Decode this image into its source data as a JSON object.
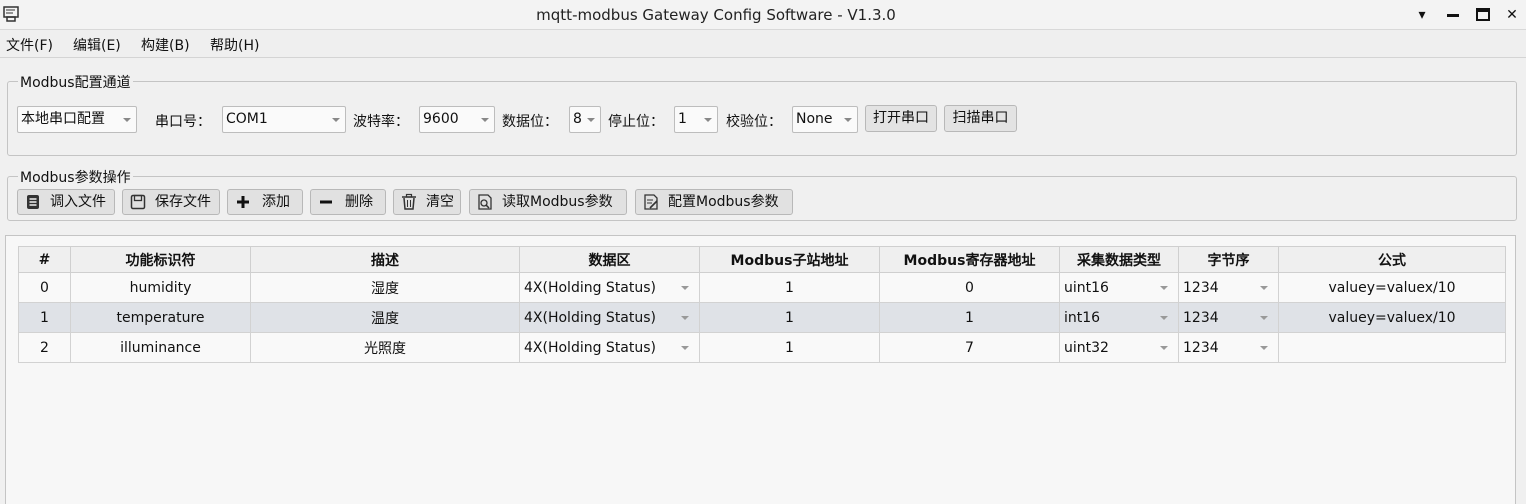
{
  "window": {
    "title": "mqtt-modbus Gateway Config Software - V1.3.0"
  },
  "menu": [
    "文件(F)",
    "编辑(E)",
    "构建(B)",
    "帮助(H)"
  ],
  "channel": {
    "group_title": "Modbus配置通道",
    "mode": "本地串口配置",
    "port_label": "串口号：",
    "port": "COM1",
    "baud_label": "波特率：",
    "baud": "9600",
    "databits_label": "数据位：",
    "databits": "8",
    "stopbits_label": "停止位：",
    "stopbits": "1",
    "parity_label": "校验位：",
    "parity": "None",
    "open_button": "打开串口",
    "scan_button": "扫描串口"
  },
  "params": {
    "group_title": "Modbus参数操作",
    "load": "调入文件",
    "save": "保存文件",
    "add": "添加",
    "delete": "删除",
    "clear": "清空",
    "read": "读取Modbus参数",
    "config": "配置Modbus参数"
  },
  "table": {
    "headers": [
      "#",
      "功能标识符",
      "描述",
      "数据区",
      "Modbus子站地址",
      "Modbus寄存器地址",
      "采集数据类型",
      "字节序",
      "公式"
    ],
    "rows": [
      [
        "0",
        "humidity",
        "湿度",
        "4X(Holding Status)",
        "1",
        "0",
        "uint16",
        "1234",
        "valuey=valuex/10"
      ],
      [
        "1",
        "temperature",
        "温度",
        "4X(Holding Status)",
        "1",
        "1",
        "int16",
        "1234",
        "valuey=valuex/10"
      ],
      [
        "2",
        "illuminance",
        "光照度",
        "4X(Holding Status)",
        "1",
        "7",
        "uint32",
        "1234",
        ""
      ]
    ],
    "selected_row": 1
  }
}
